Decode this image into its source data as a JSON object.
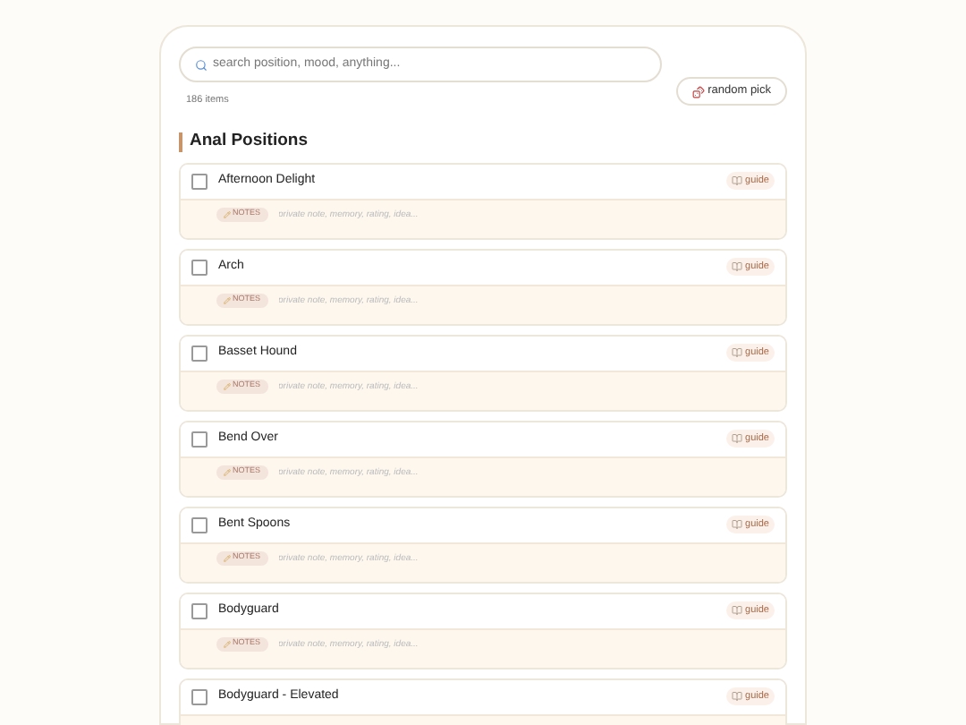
{
  "search": {
    "placeholder": "search position, mood, anything..."
  },
  "count": "186 items",
  "random_button": "random pick",
  "section": {
    "title": "Anal Positions"
  },
  "items": [
    {
      "name": "Afternoon Delight",
      "checked": false,
      "guide": "guide",
      "notes_label": "NOTES",
      "notes_placeholder": "private note, memory, rating, idea..."
    },
    {
      "name": "Arch",
      "checked": false,
      "guide": "guide",
      "notes_label": "NOTES",
      "notes_placeholder": "private note, memory, rating, idea..."
    },
    {
      "name": "Basset Hound",
      "checked": false,
      "guide": "guide",
      "notes_label": "NOTES",
      "notes_placeholder": "private note, memory, rating, idea..."
    },
    {
      "name": "Bend Over",
      "checked": false,
      "guide": "guide",
      "notes_label": "NOTES",
      "notes_placeholder": "private note, memory, rating, idea..."
    },
    {
      "name": "Bent Spoons",
      "checked": false,
      "guide": "guide",
      "notes_label": "NOTES",
      "notes_placeholder": "private note, memory, rating, idea..."
    },
    {
      "name": "Bodyguard",
      "checked": false,
      "guide": "guide",
      "notes_label": "NOTES",
      "notes_placeholder": "private note, memory, rating, idea..."
    },
    {
      "name": "Bodyguard - Elevated",
      "checked": false,
      "guide": "guide"
    }
  ]
}
